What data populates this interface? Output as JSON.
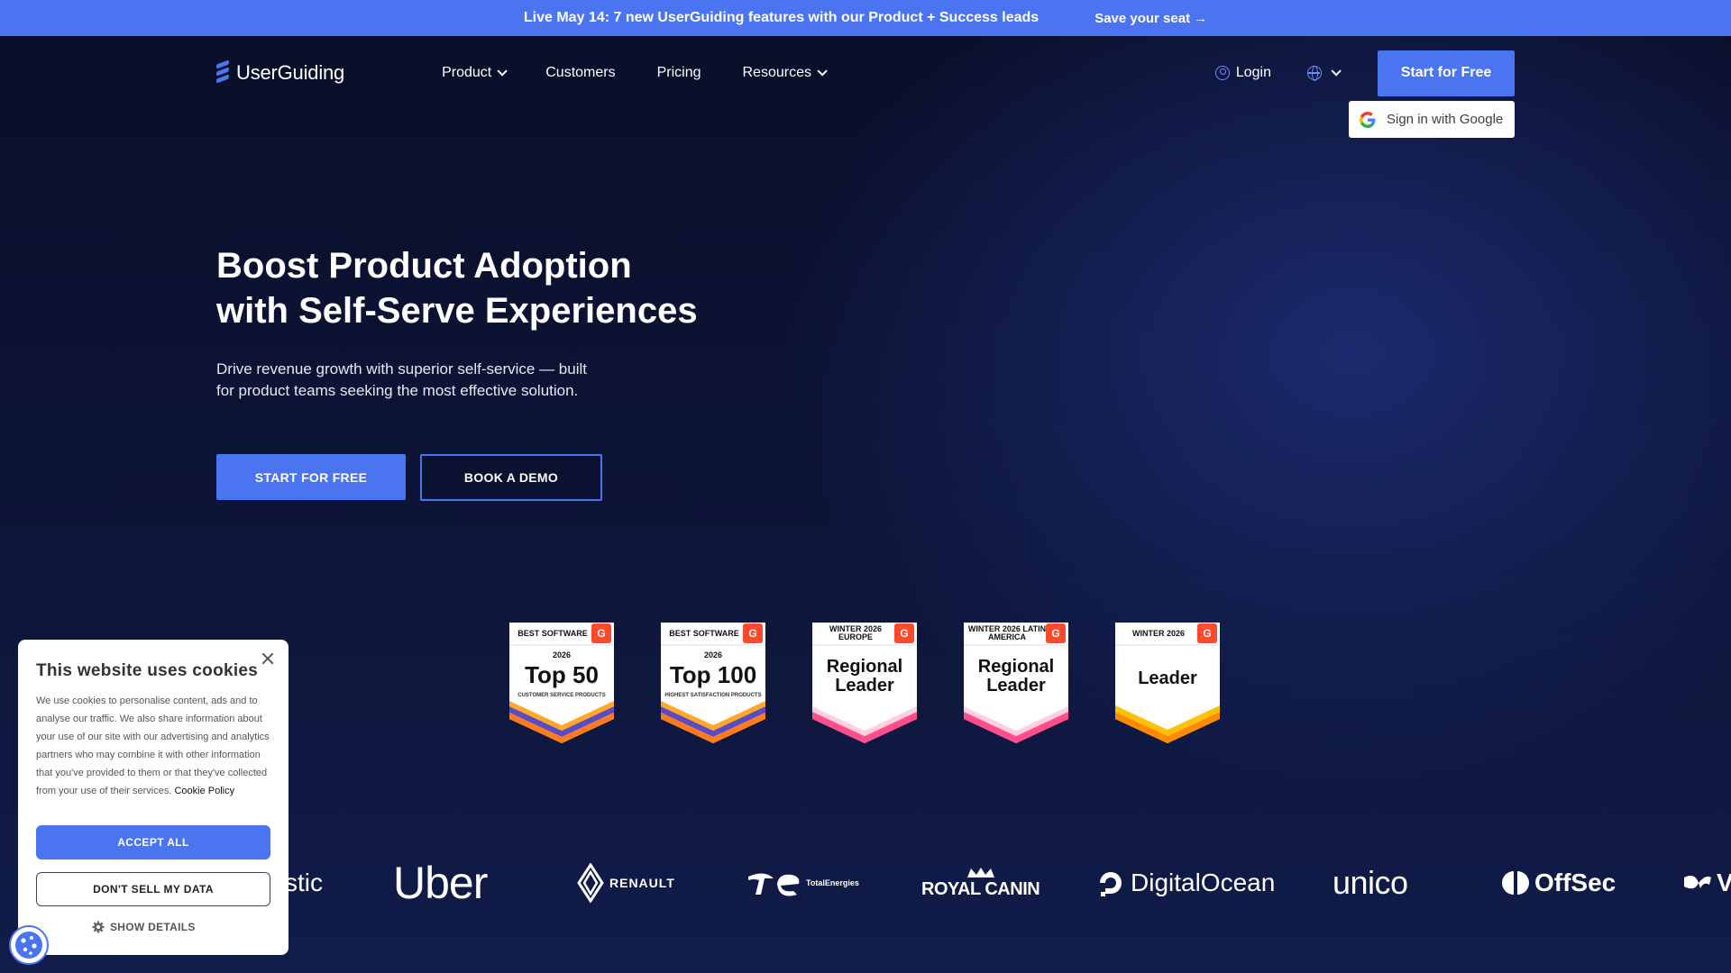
{
  "announcement": {
    "message": "Live May 14: 7 new UserGuiding features with our Product + Success leads",
    "cta": "Save your seat",
    "cta_arrow": "→"
  },
  "nav": {
    "logo_text": "UserGuiding",
    "menu": [
      {
        "label": "Product",
        "has_dropdown": true
      },
      {
        "label": "Customers",
        "has_dropdown": false
      },
      {
        "label": "Pricing",
        "has_dropdown": false
      },
      {
        "label": "Resources",
        "has_dropdown": true
      }
    ],
    "login": "Login",
    "language_icon": "globe-icon",
    "start_button": "Start for Free",
    "google_signin": "Sign in with Google"
  },
  "hero": {
    "title_line1": "Boost Product Adoption",
    "title_line2": "with Self-Serve Experiences",
    "subtitle": "Drive revenue growth with superior self-service — built for product teams seeking the most effective solution.",
    "primary_button": "START FOR FREE",
    "secondary_button": "BOOK A DEMO"
  },
  "badges": [
    {
      "top": "BEST SOFTWARE",
      "year": "2026",
      "main": "Top 50",
      "small": "CUSTOMER SERVICE PRODUCTS",
      "style": "purple"
    },
    {
      "top": "BEST SOFTWARE",
      "year": "2026",
      "main": "Top 100",
      "small": "HIGHEST SATISFACTION PRODUCTS",
      "style": "purple"
    },
    {
      "top": "WINTER 2026 EUROPE",
      "main": "Regional Leader",
      "style": "pink"
    },
    {
      "top": "WINTER 2026 LATIN AMERICA",
      "main": "Regional Leader",
      "style": "pink"
    },
    {
      "top": "WINTER 2026",
      "main": "Leader",
      "style": "orange"
    }
  ],
  "badge_g2_label": "G",
  "customer_logos": [
    "stic",
    "Uber",
    "RENAULT",
    "TotalEnergies",
    "ROYAL CANIN",
    "DigitalOcean",
    "unico",
    "OffSec",
    "V"
  ],
  "cookie": {
    "title": "This website uses cookies",
    "body": "We use cookies to personalise content, ads and to analyse our traffic. We also share information about your use of our site with our advertising and analytics partners who may combine it with other information that you've provided to them or that they've collected from your use of their services.",
    "policy_link": "Cookie Policy",
    "accept": "ACCEPT ALL",
    "dont_sell": "DON'T SELL MY DATA",
    "details": "SHOW DETAILS"
  },
  "colors": {
    "accent": "#4a74f0",
    "background": "#0b1130",
    "g2_red": "#ff492c"
  }
}
